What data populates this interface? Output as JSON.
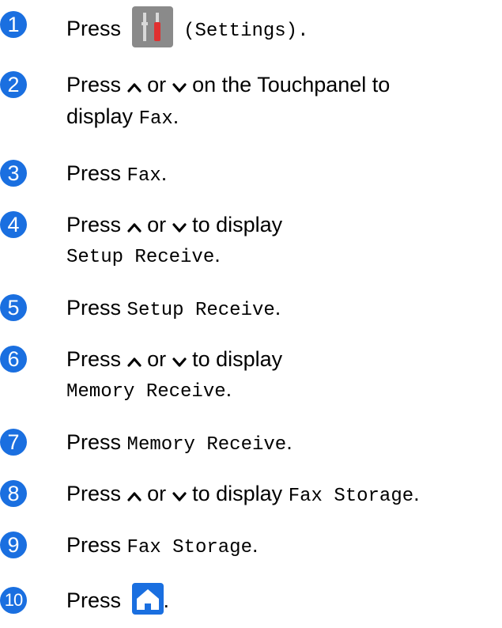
{
  "steps": [
    {
      "n": "1",
      "a": "Press",
      "b": "(Settings)."
    },
    {
      "n": "2",
      "a": "Press",
      "b": "or",
      "c": "on the Touchpanel to",
      "d": "display",
      "e": "Fax",
      "f": "."
    },
    {
      "n": "3",
      "a": "Press",
      "b": "Fax",
      "c": "."
    },
    {
      "n": "4",
      "a": "Press",
      "b": "or",
      "c": "to display",
      "d": "Setup Receive",
      "e": "."
    },
    {
      "n": "5",
      "a": "Press",
      "b": "Setup Receive",
      "c": "."
    },
    {
      "n": "6",
      "a": "Press",
      "b": "or",
      "c": "to display",
      "d": "Memory Receive",
      "e": "."
    },
    {
      "n": "7",
      "a": "Press",
      "b": "Memory Receive",
      "c": "."
    },
    {
      "n": "8",
      "a": "Press",
      "b": "or",
      "c": "to display",
      "d": "Fax Storage",
      "e": "."
    },
    {
      "n": "9",
      "a": "Press",
      "b": "Fax Storage",
      "c": "."
    },
    {
      "n": "10",
      "a": "Press",
      "b": "."
    }
  ],
  "icons": {
    "settings": "settings-icon",
    "up": "chevron-up-icon",
    "down": "chevron-down-icon",
    "home": "home-icon"
  },
  "colors": {
    "accent": "#1a6fe0",
    "icon_gray": "#8a8a8a"
  }
}
